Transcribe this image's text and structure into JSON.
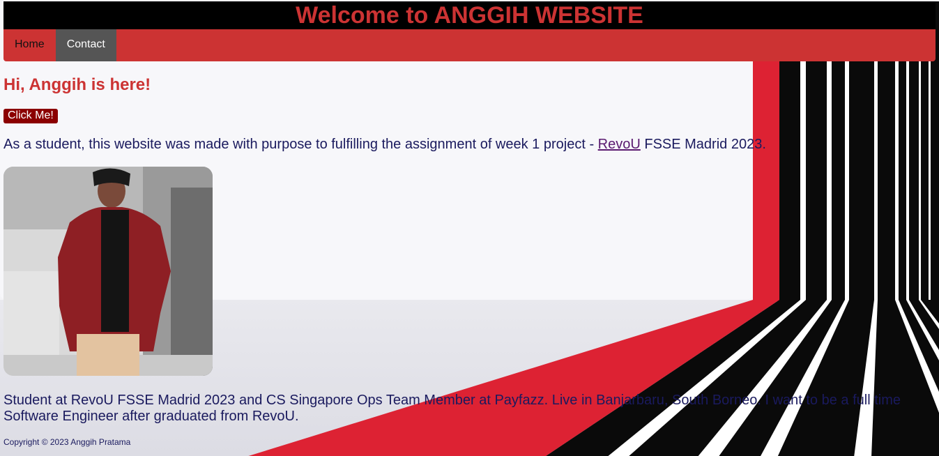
{
  "header": {
    "title": "Welcome to ANGGIH WEBSITE"
  },
  "nav": {
    "items": [
      {
        "label": "Home",
        "active": false
      },
      {
        "label": "Contact",
        "active": true
      }
    ]
  },
  "main": {
    "greeting": "Hi, Anggih is here!",
    "button_label": "Click Me!",
    "intro_before": "As a student, this website was made with purpose to fulfilling the assignment of week 1 project - ",
    "intro_link": "RevoU",
    "intro_after": " FSSE Madrid 2023.",
    "photo_icon": "profile-photo",
    "bio": "Student at RevoU FSSE Madrid 2023 and CS Singapore Ops Team Member at Payfazz. Live in Banjarbaru, South Borneo. I want to be a full time Software Engineer after graduated from RevoU."
  },
  "footer": {
    "copyright": "Copyright © 2023 Anggih Pratama"
  },
  "colors": {
    "accent": "#cc3333",
    "banner_bg": "#000000",
    "active_nav": "#555555",
    "button_bg": "#8b0000",
    "text": "#1a1a5e"
  }
}
